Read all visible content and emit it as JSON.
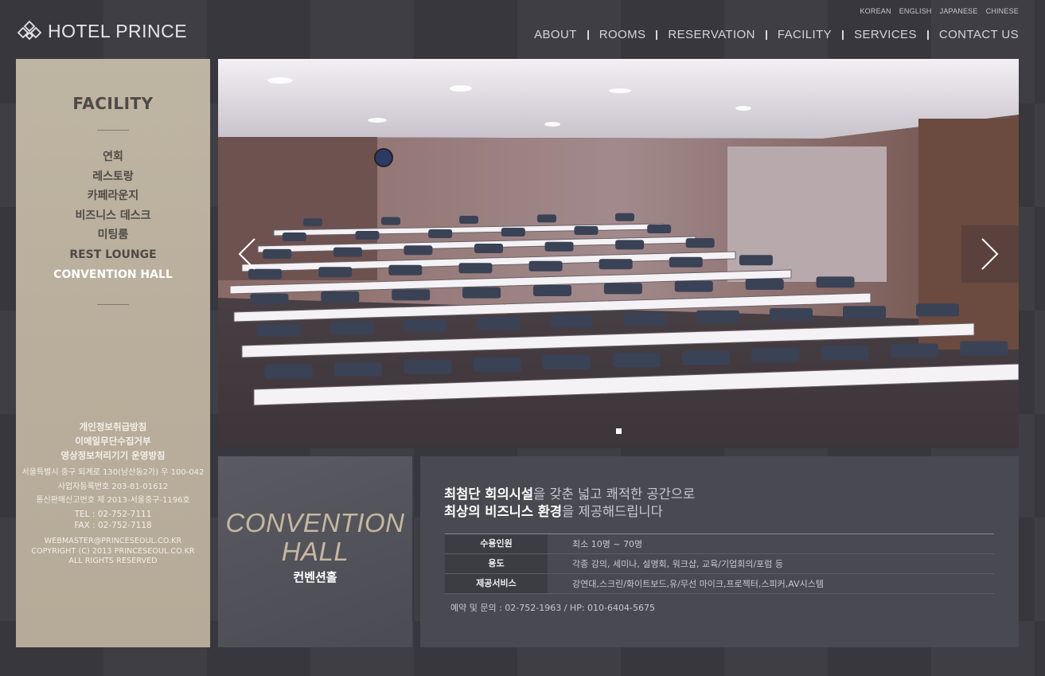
{
  "header": {
    "logo_text": "HOTEL PRINCE",
    "languages": [
      "KOREAN",
      "ENGLISH",
      "JAPANESE",
      "CHINESE"
    ],
    "nav": [
      "ABOUT",
      "ROOMS",
      "RESERVATION",
      "FACILITY",
      "SERVICES",
      "CONTACT US"
    ]
  },
  "sidebar": {
    "title": "FACILITY",
    "menu": [
      {
        "label": "연회"
      },
      {
        "label": "레스토랑"
      },
      {
        "label": "카페라운지"
      },
      {
        "label": "비즈니스 데스크"
      },
      {
        "label": "미팅룸"
      },
      {
        "label": "REST LOUNGE"
      },
      {
        "label": "CONVENTION HALL"
      }
    ],
    "policy_links": [
      "개인정보취급방침",
      "이메일무단수집거부",
      "영상정보처리기기 운영방침"
    ],
    "address_lines": [
      "서울특별시 중구 퇴계로 130(남산동2가) 우 100-042",
      "사업자등록번호  203-81-01612",
      "통신판매신고번호 제 2013-서울중구-1196호"
    ],
    "contact_lines": [
      "TEL : 02-752-7111",
      "FAX : 02-752-7118"
    ],
    "copyright_lines": [
      "WEBMASTER@PRINCESEOUL.CO.KR",
      "COPYRIGHT (C) 2013 PRINCESEOUL.CO.KR",
      "ALL RIGHTS RESERVED"
    ]
  },
  "slider": {
    "active_index": 0,
    "dot_count": 1
  },
  "hall": {
    "title_line1": "CONVENTION",
    "title_line2": "HALL",
    "title_ko": "컨벤션홀"
  },
  "info": {
    "headline": {
      "l1_a": "최첨단 회의시설",
      "l1_b": "을 갖춘 넓고 쾌적한 공간으로",
      "l2_a": "최상의 비즈니스 환경",
      "l2_b": "을 제공해드립니다"
    },
    "rows": [
      {
        "label": "수용인원",
        "value": "최소 10명 ~ 70명"
      },
      {
        "label": "용도",
        "value": "각종 강의, 세미나, 설명회, 워크샵, 교육/기업회의/포럼 등"
      },
      {
        "label": "제공서비스",
        "value": "강연대,스크린/화이트보드,유/무선 마이크,프로젝터,스피커,AV시스템"
      }
    ],
    "contact": "예약 및 문의 : 02-752-1963 / HP: 010-6404-5675"
  },
  "colors": {
    "background": "#37373d",
    "sidebar": "#bcb19f",
    "accent_gold": "#c6b89f",
    "panel": "#494951"
  }
}
